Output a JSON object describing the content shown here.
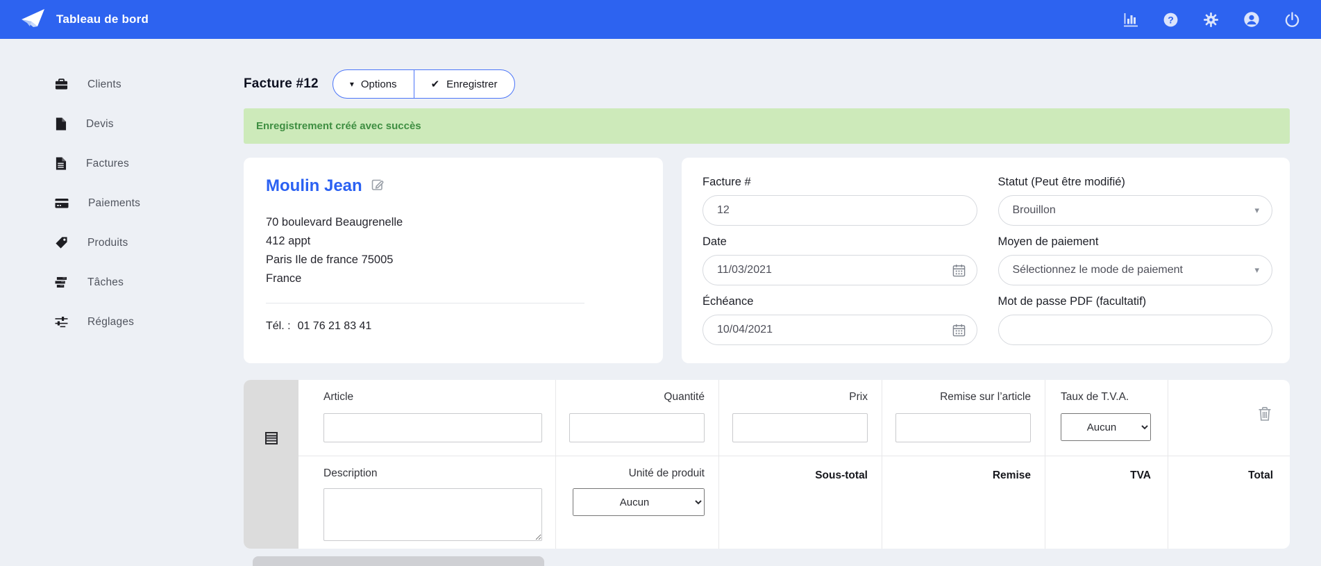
{
  "colors": {
    "navbar": "#2d63f0",
    "accent": "#4a74f8",
    "link_blue": "#2b61f2",
    "alert_bg": "#cdeaba",
    "alert_text": "#3e8e41"
  },
  "navbar": {
    "brand": "Tableau de bord",
    "icons": [
      "reports-icon",
      "help-icon",
      "settings-icon",
      "account-icon",
      "logout-icon"
    ]
  },
  "sidebar": {
    "items": [
      {
        "label": "Clients",
        "icon": "briefcase-icon"
      },
      {
        "label": "Devis",
        "icon": "file-icon"
      },
      {
        "label": "Factures",
        "icon": "file-text-icon"
      },
      {
        "label": "Paiements",
        "icon": "credit-card-icon"
      },
      {
        "label": "Produits",
        "icon": "tag-icon"
      },
      {
        "label": "Tâches",
        "icon": "tasks-icon"
      },
      {
        "label": "Réglages",
        "icon": "sliders-icon"
      }
    ]
  },
  "header": {
    "title": "Facture #12",
    "options_label": "Options",
    "save_label": "Enregistrer"
  },
  "alert": {
    "message": "Enregistrement créé avec succès"
  },
  "client_card": {
    "name": "Moulin Jean",
    "address_lines": [
      "70 boulevard Beaugrenelle",
      "412 appt",
      "Paris Ile de france 75005",
      "France"
    ],
    "phone_label": "Tél. :",
    "phone": "01 76 21 83 41"
  },
  "invoice_form": {
    "invoice_number": {
      "label": "Facture #",
      "value": "12"
    },
    "date": {
      "label": "Date",
      "value": "11/03/2021"
    },
    "due_date": {
      "label": "Échéance",
      "value": "10/04/2021"
    },
    "status": {
      "label": "Statut (Peut être modifié)",
      "value": "Brouillon"
    },
    "payment_method": {
      "label": "Moyen de paiement",
      "value": "Sélectionnez le mode de paiement"
    },
    "pdf_password": {
      "label": "Mot de passe PDF (facultatif)",
      "value": ""
    }
  },
  "items_table": {
    "article_label": "Article",
    "quantity_label": "Quantité",
    "price_label": "Prix",
    "item_discount_label": "Remise sur l’article",
    "tax_rate_label": "Taux de T.V.A.",
    "tax_rate_value": "Aucun",
    "description_label": "Description",
    "unit_label": "Unité de produit",
    "unit_value": "Aucun",
    "subtotal_label": "Sous-total",
    "discount_label": "Remise",
    "tva_label": "TVA",
    "total_label": "Total"
  }
}
